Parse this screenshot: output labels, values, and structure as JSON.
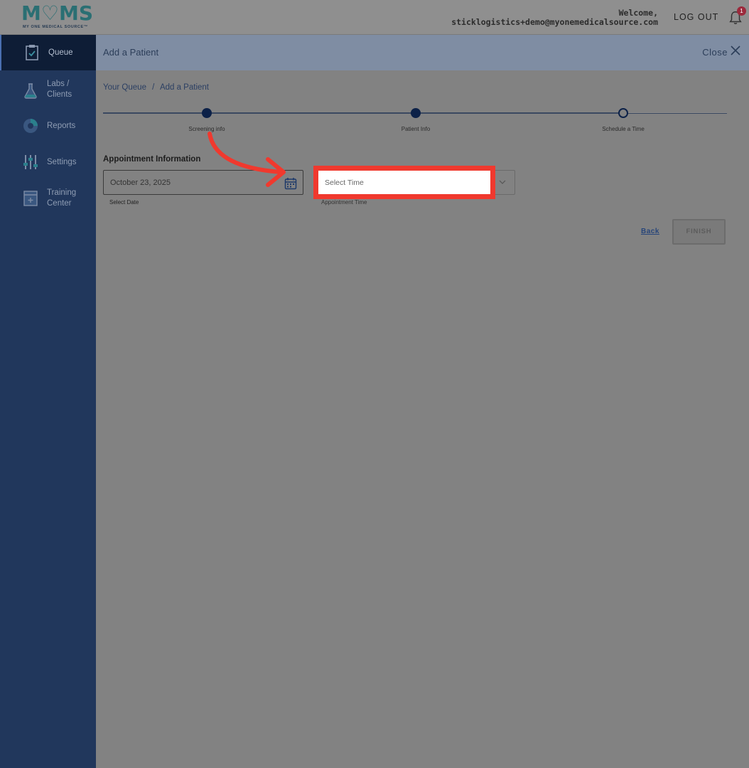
{
  "header": {
    "logo": {
      "main": "MOMS",
      "sub": "MY ONE MEDICAL SOURCE™"
    },
    "welcome_label": "Welcome,",
    "user_email": "sticklogistics+demo@myonemedicalsource.com",
    "logout_label": "LOG OUT",
    "notification_count": "1"
  },
  "sidebar": {
    "items": [
      {
        "label": "Queue",
        "icon": "clipboard-check-icon",
        "active": true
      },
      {
        "label_line1": "Labs /",
        "label_line2": "Clients",
        "icon": "flask-icon"
      },
      {
        "label": "Reports",
        "icon": "pie-chart-icon"
      },
      {
        "label": "Settings",
        "icon": "sliders-icon"
      },
      {
        "label_line1": "Training",
        "label_line2": "Center",
        "icon": "book-icon"
      }
    ]
  },
  "titlebar": {
    "title": "Add a Patient",
    "close_label": "Close"
  },
  "breadcrumb": {
    "items": [
      "Your Queue",
      "Add a Patient"
    ],
    "separator": "/"
  },
  "stepper": {
    "steps": [
      {
        "label": "Screening info",
        "state": "complete"
      },
      {
        "label": "Patient Info",
        "state": "complete"
      },
      {
        "label": "Schedule a Time",
        "state": "current"
      }
    ]
  },
  "form": {
    "section_title": "Appointment Information",
    "date": {
      "value": "October 23, 2025",
      "helper": "Select Date"
    },
    "time": {
      "placeholder": "Select Time",
      "helper": "Appointment Time"
    }
  },
  "actions": {
    "back_label": "Back",
    "finish_label": "FINISH"
  },
  "annotation": {
    "highlight_color": "#f0392e"
  }
}
